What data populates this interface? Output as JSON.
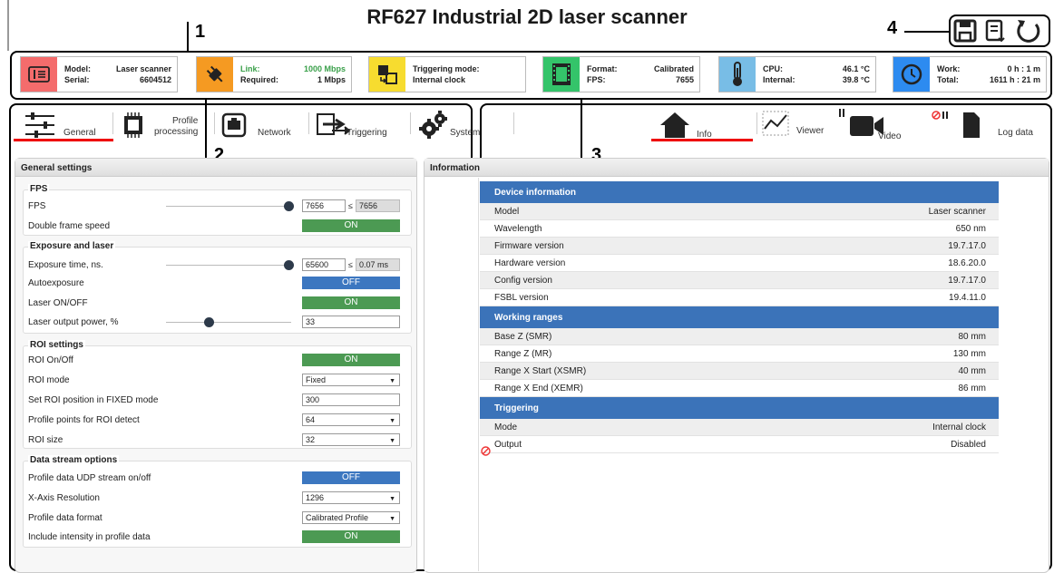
{
  "title": "RF627 Industrial 2D laser scanner",
  "annotations": [
    "1",
    "2",
    "3",
    "4"
  ],
  "status": {
    "model_key": "Model:",
    "model_val": "Laser scanner",
    "serial_key": "Serial:",
    "serial_val": "6604512",
    "link_key": "Link:",
    "link_val": "1000 Mbps",
    "req_key": "Required:",
    "req_val": "1 Mbps",
    "trig_key": "Triggering mode:",
    "trig_val": "Internal clock",
    "format_key": "Format:",
    "format_val": "Calibrated",
    "fps_key": "FPS:",
    "fps_val": "7655",
    "cpu_key": "CPU:",
    "cpu_val": "46.1 °C",
    "internal_key": "Internal:",
    "internal_val": "39.8 °C",
    "work_key": "Work:",
    "work_val": "0 h : 1 m",
    "total_key": "Total:",
    "total_val": "1611 h : 21 m"
  },
  "left_tabs": {
    "general": "General",
    "profile_1": "Profile",
    "profile_2": "processing",
    "network": "Network",
    "triggering": "Triggering",
    "system": "System"
  },
  "right_tabs": {
    "info": "Info",
    "viewer": "Viewer",
    "video": "Video",
    "log": "Log data"
  },
  "settings": {
    "header": "General settings",
    "fps_group": "FPS",
    "fps_label": "FPS",
    "fps_value": "7656",
    "fps_max": "7656",
    "le": "≤",
    "double_frame": "Double frame speed",
    "double_frame_state": "ON",
    "exposure_group": "Exposure and laser",
    "exposure_label": "Exposure time, ns.",
    "exposure_value": "65600",
    "exposure_max": "0.07 ms",
    "autoexposure": "Autoexposure",
    "autoexposure_state": "OFF",
    "laser_onoff": "Laser ON/OFF",
    "laser_onoff_state": "ON",
    "laser_power": "Laser output power, %",
    "laser_power_value": "33",
    "roi_group": "ROI settings",
    "roi_onoff": "ROI On/Off",
    "roi_onoff_state": "ON",
    "roi_mode": "ROI mode",
    "roi_mode_value": "Fixed",
    "roi_pos": "Set ROI position in FIXED mode",
    "roi_pos_value": "300",
    "roi_points": "Profile points for ROI detect",
    "roi_points_value": "64",
    "roi_size": "ROI size",
    "roi_size_value": "32",
    "stream_group": "Data stream options",
    "udp_stream": "Profile data UDP stream on/off",
    "udp_stream_state": "OFF",
    "xres": "X-Axis Resolution",
    "xres_value": "1296",
    "pformat": "Profile data format",
    "pformat_value": "Calibrated Profile",
    "intensity": "Include intensity in profile data",
    "intensity_state": "ON"
  },
  "info": {
    "header": "Information",
    "sections": [
      {
        "title": "Device information",
        "rows": [
          [
            "Model",
            "Laser scanner"
          ],
          [
            "Wavelength",
            "650 nm"
          ],
          [
            "Firmware version",
            "19.7.17.0"
          ],
          [
            "Hardware version",
            "18.6.20.0"
          ],
          [
            "Config version",
            "19.7.17.0"
          ],
          [
            "FSBL version",
            "19.4.11.0"
          ]
        ]
      },
      {
        "title": "Working ranges",
        "rows": [
          [
            "Base Z (SMR)",
            "80 mm"
          ],
          [
            "Range Z (MR)",
            "130 mm"
          ],
          [
            "Range X Start (XSMR)",
            "40 mm"
          ],
          [
            "Range X End (XEMR)",
            "86 mm"
          ]
        ]
      },
      {
        "title": "Triggering",
        "rows": [
          [
            "Mode",
            "Internal clock"
          ],
          [
            "Output",
            "Disabled"
          ]
        ]
      }
    ]
  },
  "colors": {
    "card1": "#f46c6c",
    "card2": "#f59a22",
    "card3": "#f7dc2f",
    "card4": "#34c46a",
    "card5": "#78bde6",
    "card6": "#2d8bf0",
    "accent_blue": "#3b73b9",
    "on_green": "#4c9a53",
    "tab_underline": "#e00000"
  }
}
